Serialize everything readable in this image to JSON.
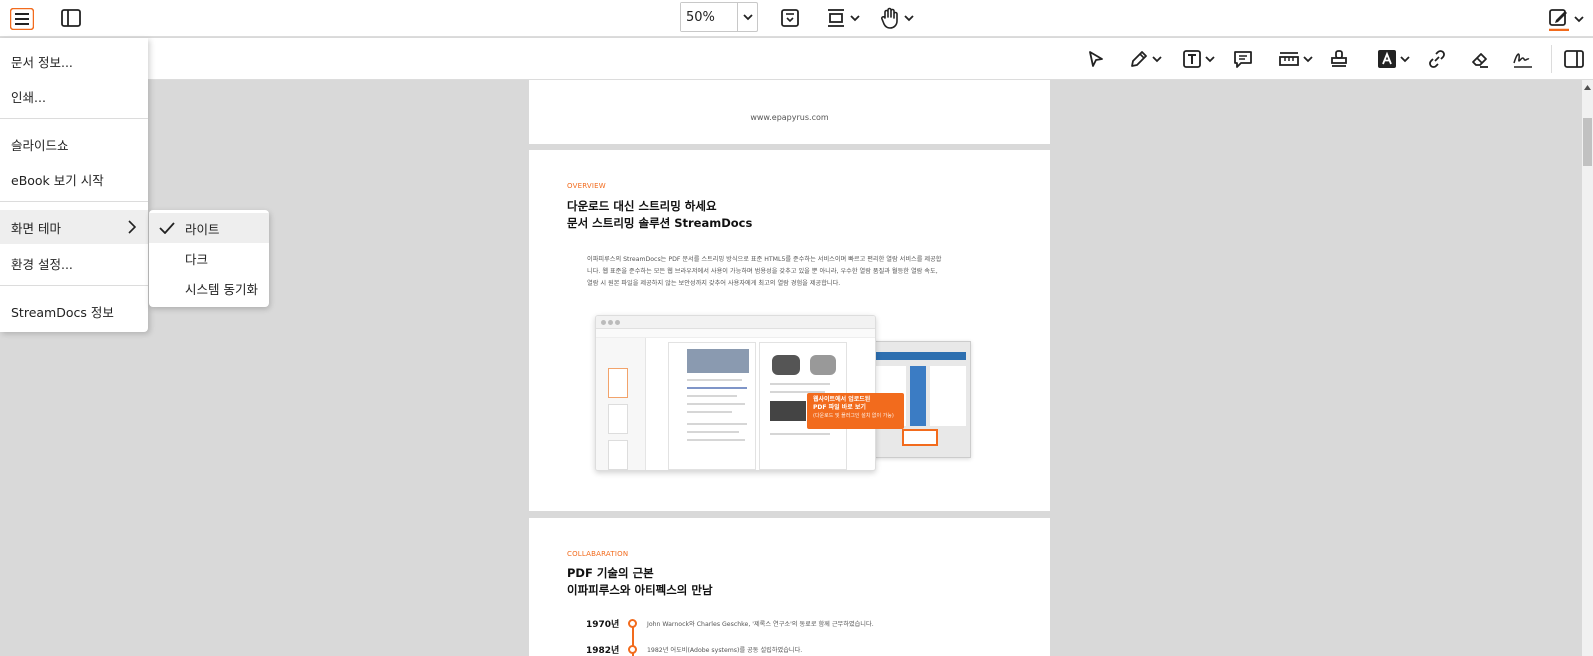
{
  "toolbar": {
    "zoom_value": "50%",
    "accent_color": "#f26b1d",
    "icons": [
      "menu-icon",
      "sidebar-toggle-icon",
      "fit-page-icon",
      "page-layout-icon",
      "pan-hand-icon",
      "edit-mode-icon"
    ]
  },
  "annotation_toolbar": {
    "icons": [
      "select-pointer-icon",
      "pen-icon",
      "text-box-icon",
      "comment-icon",
      "measure-icon",
      "stamp-icon",
      "font-color-icon",
      "link-icon",
      "eraser-icon",
      "signature-icon",
      "right-panel-icon"
    ]
  },
  "main_menu": {
    "items": [
      {
        "label": "문서 정보..."
      },
      {
        "label": "인쇄..."
      },
      {
        "label": "슬라이드쇼"
      },
      {
        "label": "eBook 보기 시작"
      },
      {
        "label": "화면 테마"
      },
      {
        "label": "환경 설정..."
      },
      {
        "label": "StreamDocs 정보"
      }
    ]
  },
  "theme_submenu": {
    "selected": "라이트",
    "items": [
      {
        "label": "라이트"
      },
      {
        "label": "다크"
      },
      {
        "label": "시스템 동기화"
      }
    ]
  },
  "document": {
    "page1": {
      "footer_url": "www.epapyrus.com"
    },
    "page2": {
      "eyebrow": "OVERVIEW",
      "heading_line1": "다운로드 대신 스트리밍 하세요",
      "heading_line2": "문서 스트리밍 솔루션 StreamDocs",
      "paragraph_line1": "이파피루스의 StreamDocs는 PDF 문서를 스트리밍 방식으로 표준 HTML5를 준수하는 서비스이며 빠르고 편리한 열람 서비스를 제공합",
      "paragraph_line2": "니다. 웹 표준을 준수하는 모든 웹 브라우저에서 사용이 가능하며 범용성을 갖추고 있을 뿐 아니라, 우수한 열람 품질과 월등한 열람 속도,",
      "paragraph_line3": "열람 시 원본 파일을 제공하지 않는 보안성까지 갖추어 사용자에게 최고의 열람 경험을 제공합니다.",
      "callout_line1": "웹사이트에서 업로드된",
      "callout_line2": "PDF 파일 바로 보기",
      "callout_sub": "(다운로드 및 플러그인 설치 없이 가능)"
    },
    "page3": {
      "eyebrow": "COLLABARATION",
      "heading_line1": "PDF 기술의 근본",
      "heading_line2": "이파피루스와 아티펙스의 만남",
      "timeline": [
        {
          "year": "1970년",
          "text": "John Warnock와 Charles Geschke, '제록스 연구소'의 동료로 함께 근무하였습니다."
        },
        {
          "year": "1982년",
          "text": "1982년 어도비(Adobe systems)를 공동 설립하였습니다."
        }
      ]
    }
  }
}
